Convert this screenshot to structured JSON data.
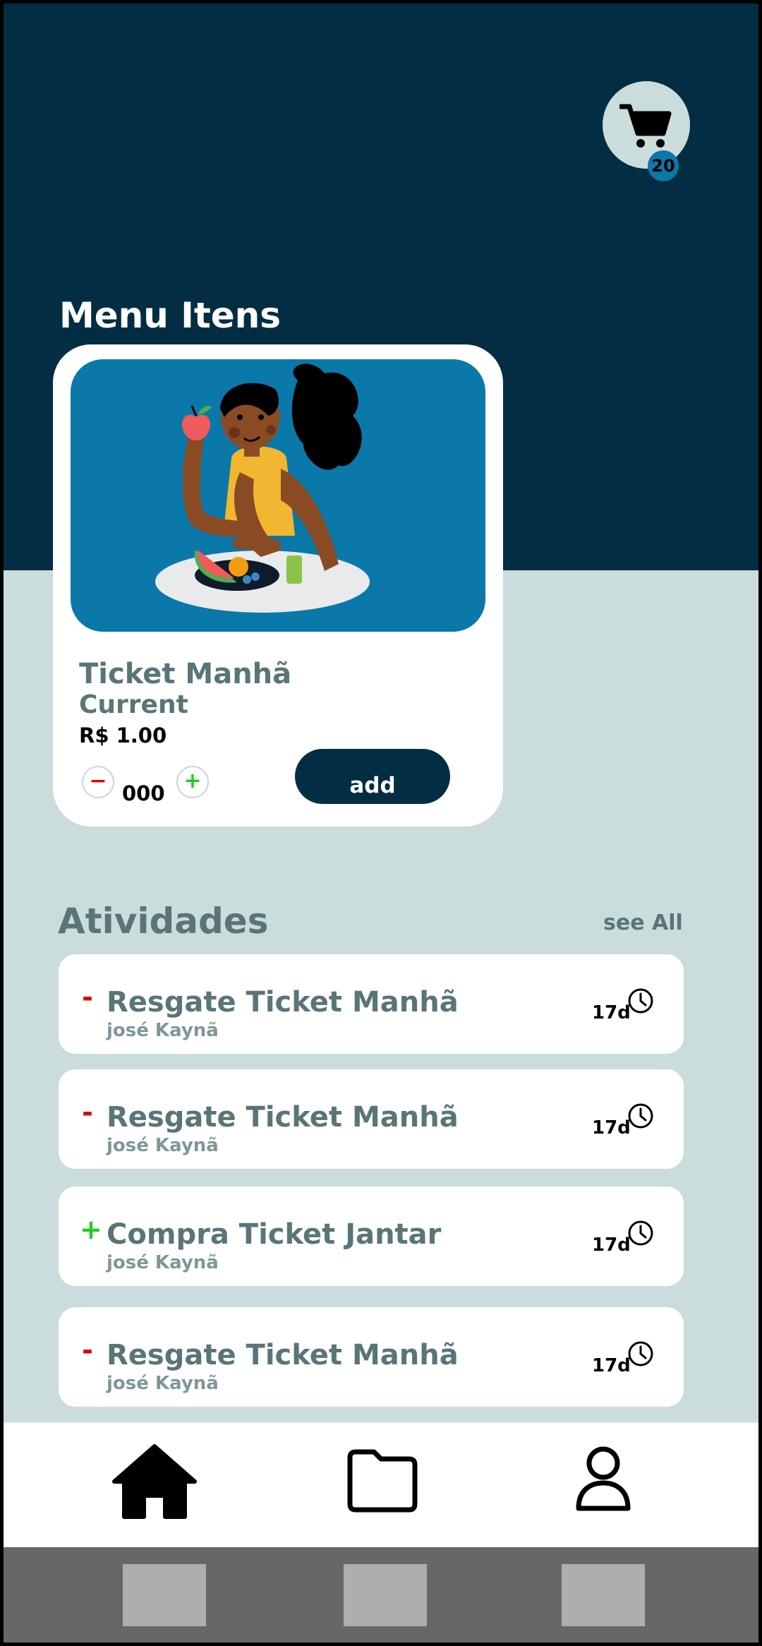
{
  "header": {
    "cart_badge": "20",
    "cart_icon": "shopping-cart-icon",
    "colors": {
      "header_bg": "#032d43",
      "page_bg": "#cbdcdd",
      "accent": "#0a78a8"
    }
  },
  "menu": {
    "title": "Menu Itens",
    "item": {
      "name": "Ticket Manhã",
      "subtitle": "Current",
      "price": "R$ 1.00",
      "quantity": "000",
      "minus_label": "−",
      "plus_label": "+",
      "add_label": "add"
    }
  },
  "activities": {
    "title": "Atividades",
    "see_all": "see All",
    "items": [
      {
        "sign": "-",
        "name": "Resgate Ticket Manhã",
        "user": "josé Kaynã",
        "time": "17d"
      },
      {
        "sign": "-",
        "name": "Resgate Ticket Manhã",
        "user": "josé Kaynã",
        "time": "17d"
      },
      {
        "sign": "+",
        "name": "Compra Ticket Jantar",
        "user": "josé Kaynã",
        "time": "17d"
      },
      {
        "sign": "-",
        "name": "Resgate Ticket Manhã",
        "user": "josé Kaynã",
        "time": "17d"
      }
    ]
  },
  "bottom_nav": {
    "items": [
      {
        "icon": "home-icon"
      },
      {
        "icon": "folder-icon"
      },
      {
        "icon": "user-icon"
      }
    ]
  }
}
